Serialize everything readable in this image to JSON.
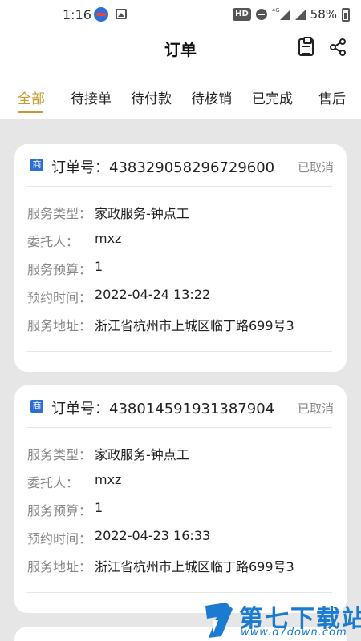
{
  "status_bar": {
    "time": "1:16",
    "hd_label": "HD",
    "network_label": "4G",
    "battery": "58%"
  },
  "header": {
    "title": "订单",
    "icons": [
      "clipboard-icon",
      "share-icon"
    ]
  },
  "tabs": [
    {
      "label": "全部",
      "active": true
    },
    {
      "label": "待接单",
      "active": false
    },
    {
      "label": "待付款",
      "active": false
    },
    {
      "label": "待核销",
      "active": false
    },
    {
      "label": "已完成",
      "active": false
    },
    {
      "label": "售后",
      "active": false
    }
  ],
  "orders": [
    {
      "shop_badge": "商",
      "order_label": "订单号：",
      "order_no": "438329058296729600",
      "status": "已取消",
      "fields": [
        {
          "key": "服务类型：",
          "value": "家政服务-钟点工"
        },
        {
          "key": "委托人：",
          "value": "mxz"
        },
        {
          "key": "服务预算：",
          "value": "1"
        },
        {
          "key": "预约时间：",
          "value": "2022-04-24 13:22"
        },
        {
          "key": "服务地址：",
          "value": "浙江省杭州市上城区临丁路699号3"
        }
      ]
    },
    {
      "shop_badge": "商",
      "order_label": "订单号：",
      "order_no": "438014591931387904",
      "status": "已取消",
      "fields": [
        {
          "key": "服务类型：",
          "value": "家政服务-钟点工"
        },
        {
          "key": "委托人：",
          "value": "mxz"
        },
        {
          "key": "服务预算：",
          "value": "1"
        },
        {
          "key": "预约时间：",
          "value": "2022-04-23 16:33"
        },
        {
          "key": "服务地址：",
          "value": "浙江省杭州市上城区临丁路699号3"
        }
      ]
    }
  ],
  "watermark": {
    "text": "第七下载站",
    "url": "www.d7down.com"
  },
  "colors": {
    "accent": "#c79a2d",
    "background": "#e6e6e6",
    "badge_blue": "#2d6ed6",
    "muted": "#888888"
  }
}
